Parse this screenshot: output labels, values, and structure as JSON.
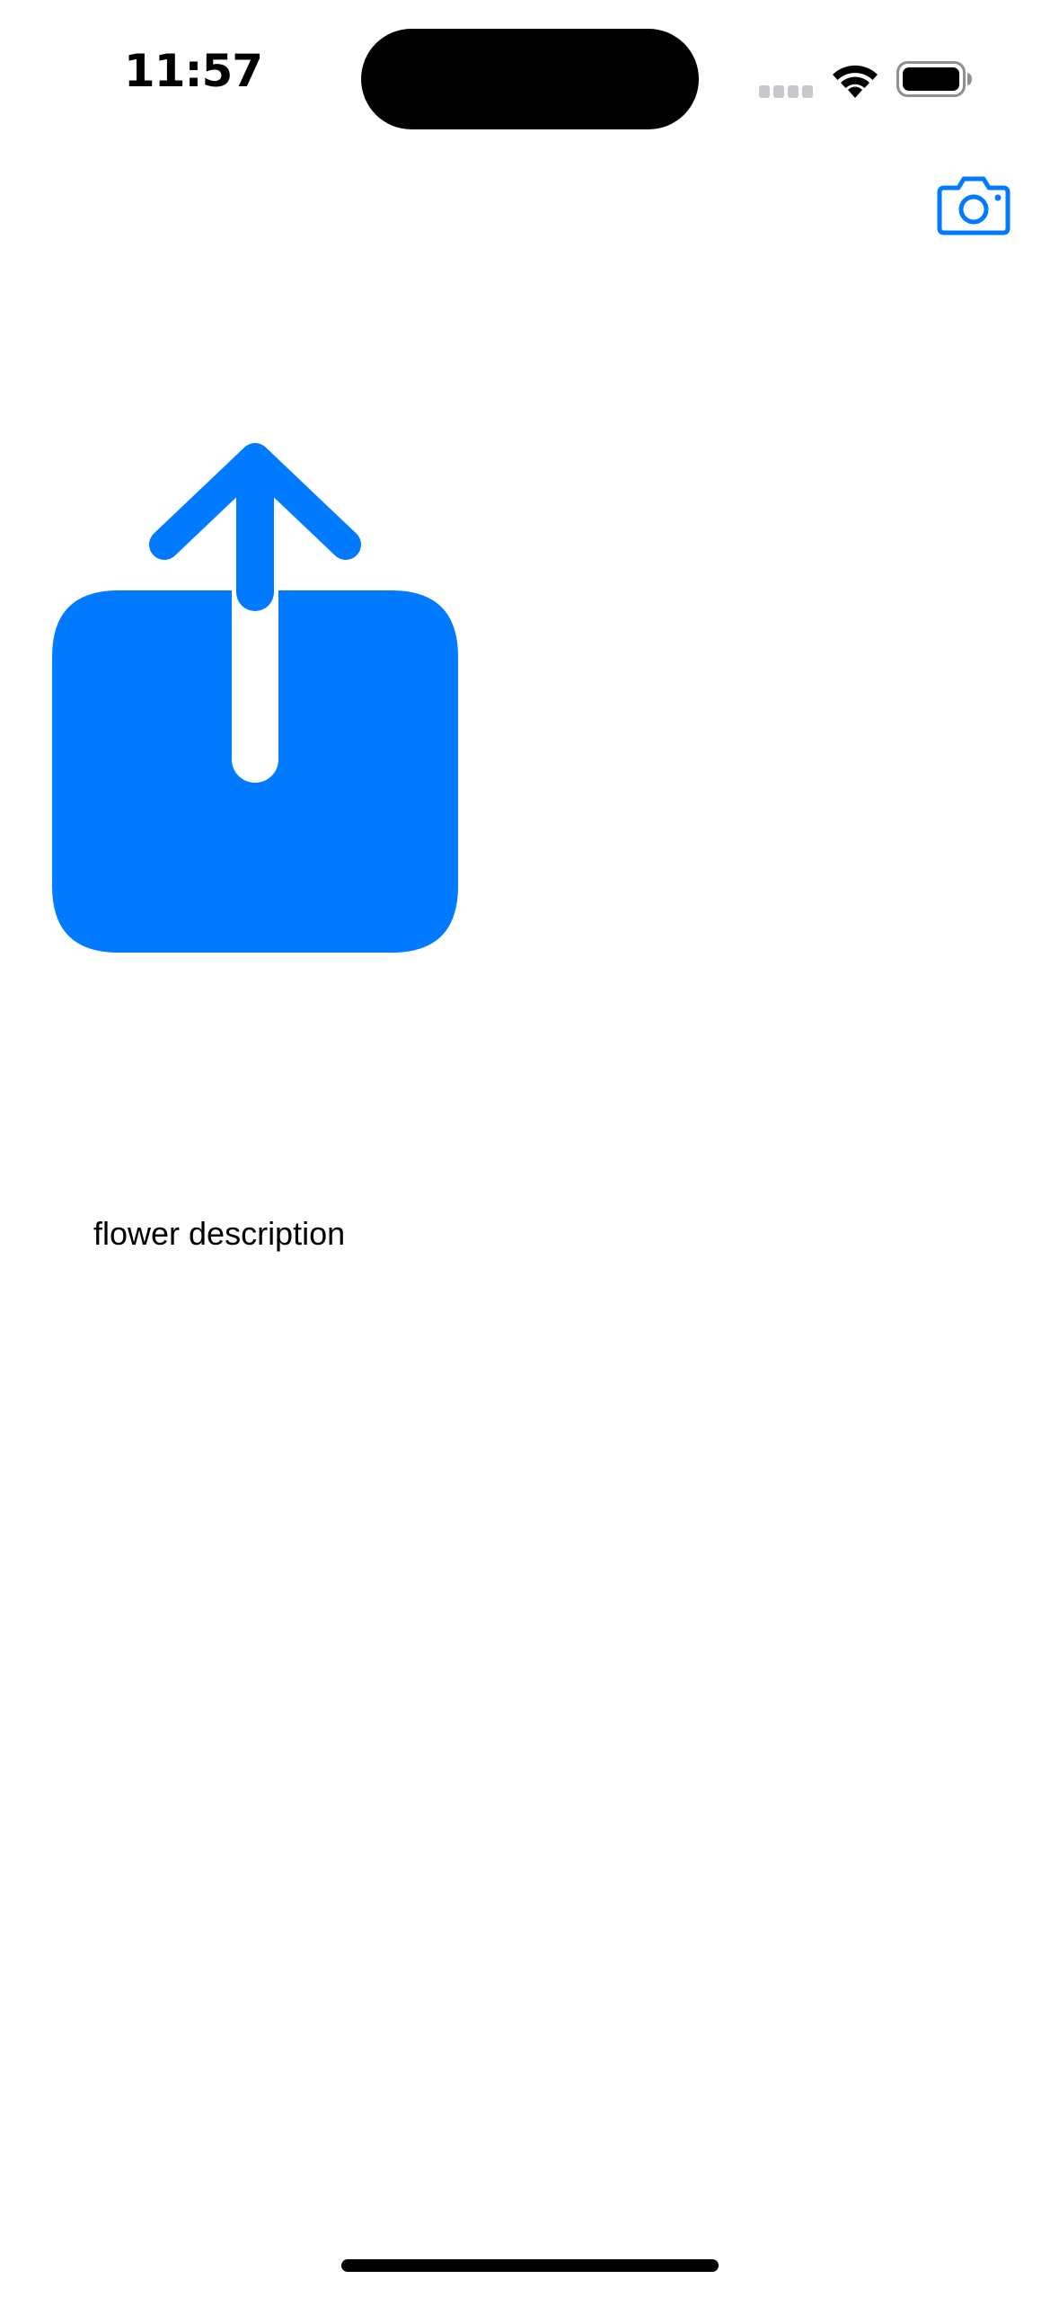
{
  "status_bar": {
    "time": "11:57"
  },
  "toolbar": {
    "camera_icon": "camera-icon"
  },
  "content": {
    "image_icon": "square-and-arrow-up-icon",
    "description": "flower description"
  },
  "colors": {
    "accent": "#007AFF",
    "text": "#000000",
    "background": "#FFFFFF"
  }
}
